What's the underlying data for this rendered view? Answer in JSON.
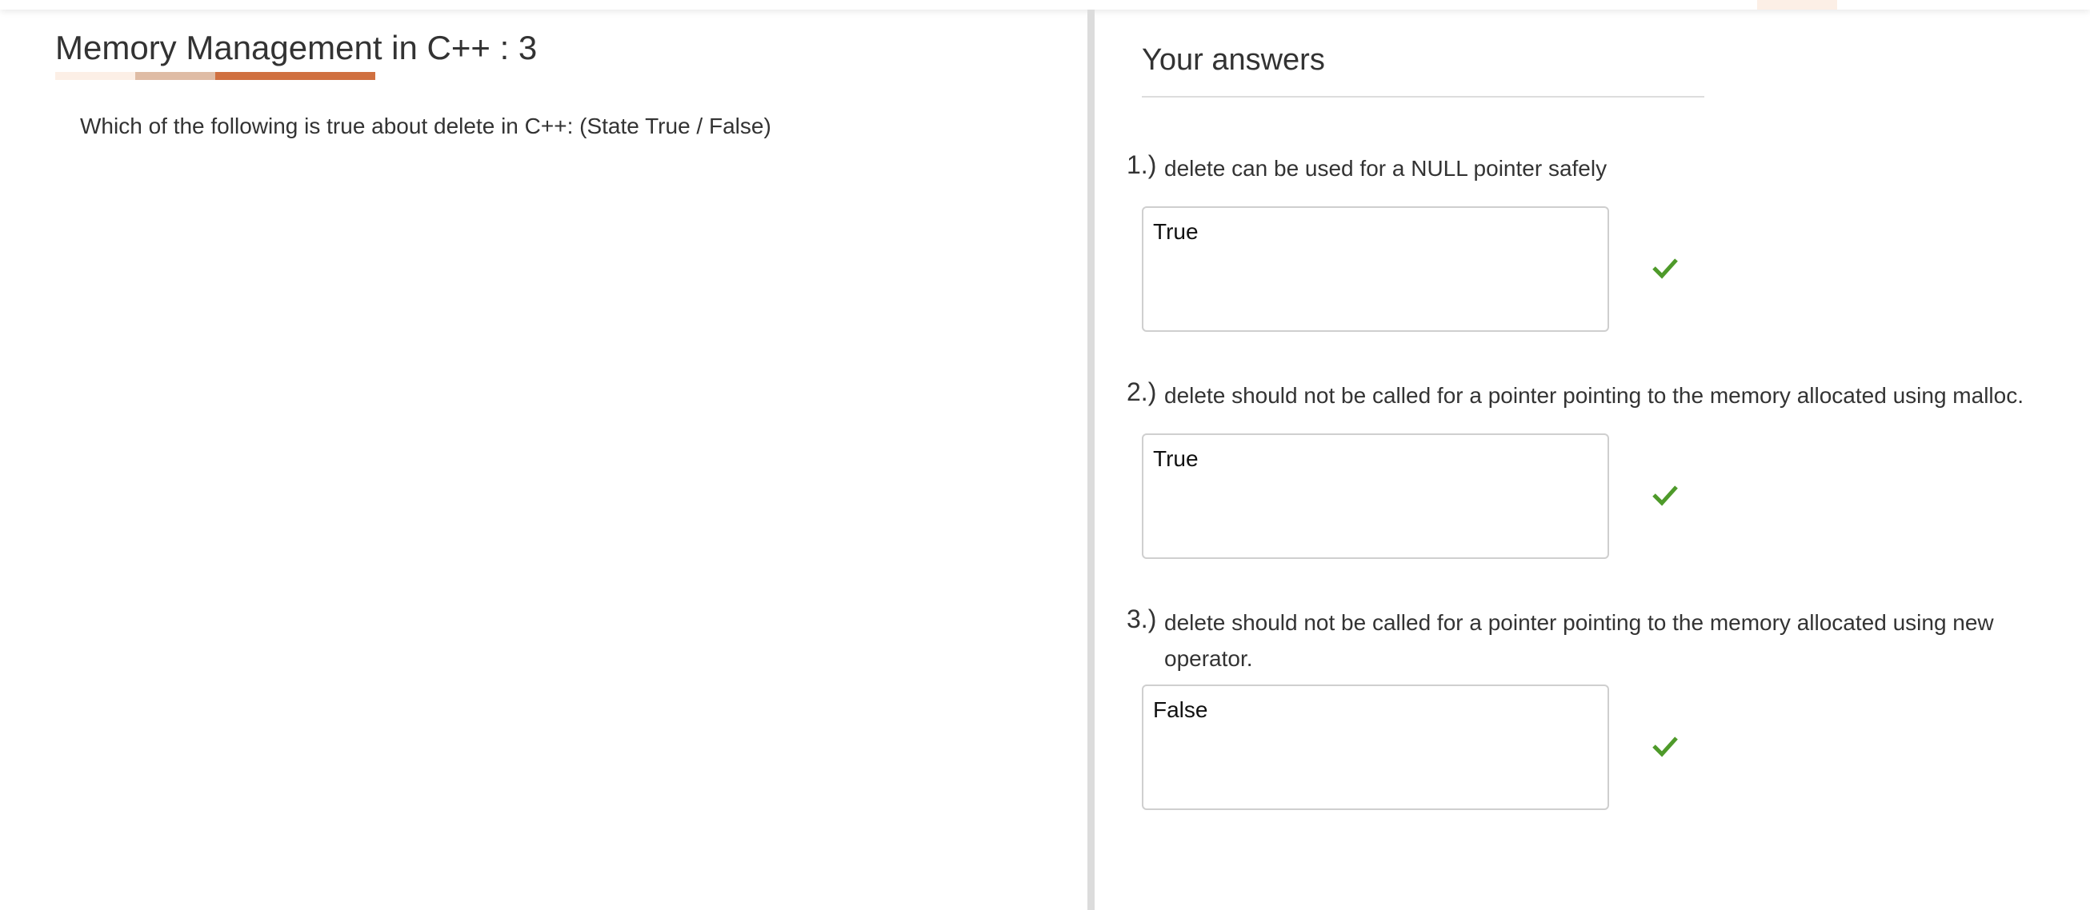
{
  "header": {
    "title": "Memory Management in C++ : 3"
  },
  "question": {
    "text": "Which of the following is true about delete in C++: (State True / False)"
  },
  "answers": {
    "title": "Your answers",
    "items": [
      {
        "number": "1.)",
        "text": "delete can be used for a NULL pointer safely",
        "answer": "True",
        "status": "correct"
      },
      {
        "number": "2.)",
        "text": "delete should not be called for a pointer pointing to the memory allocated using malloc.",
        "answer": "True",
        "status": "correct"
      },
      {
        "number": "3.)",
        "text": "delete should not be called for a pointer pointing to the memory allocated using new operator.",
        "answer": "False",
        "status": "correct"
      }
    ]
  },
  "colors": {
    "accent": "#d07040",
    "accent_mid": "#dfbca5",
    "accent_light": "#fcefe6",
    "check": "#4e9a2a"
  }
}
